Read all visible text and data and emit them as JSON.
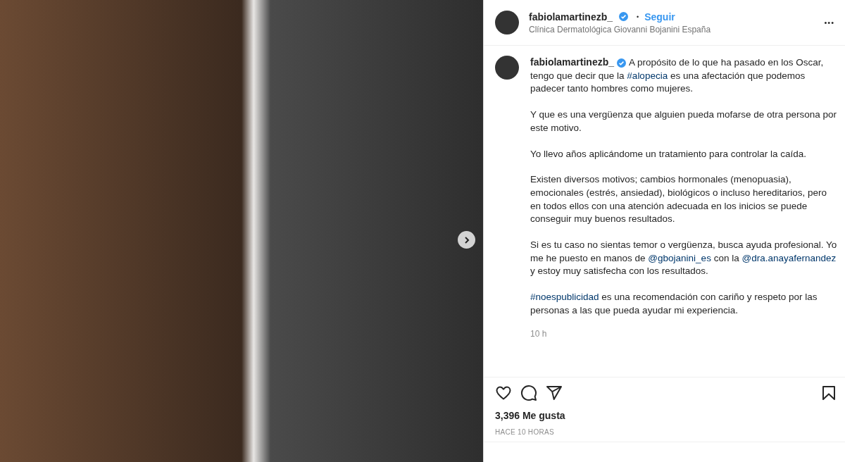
{
  "post": {
    "username": "fabiolamartinezb_",
    "verified": true,
    "separator": "•",
    "follow": "Seguir",
    "location": "Clínica Dermatológica Giovanni Bojanini España",
    "more": "•••"
  },
  "caption": {
    "username": "fabiolamartinezb_",
    "verified": true,
    "paragraphs": [
      [
        {
          "kind": "text",
          "text": "A propósito de lo que ha pasado en los Oscar, tengo que decir que la "
        },
        {
          "kind": "link",
          "text": "#alopecia"
        },
        {
          "kind": "text",
          "text": " es una afectación que podemos padecer tanto hombres como mujeres."
        }
      ],
      [
        {
          "kind": "text",
          "text": "Y que es una vergüenza que alguien pueda mofarse de otra persona por este motivo."
        }
      ],
      [
        {
          "kind": "text",
          "text": "Yo llevo años aplicándome un tratamiento para controlar la caída."
        }
      ],
      [
        {
          "kind": "text",
          "text": "Existen diversos motivos; cambios hormonales (menopuasia), emocionales (estrés, ansiedad), biológicos o incluso hereditarios, pero en todos ellos con una atención adecuada en los inicios se puede conseguir muy buenos resultados."
        }
      ],
      [
        {
          "kind": "text",
          "text": "Si es tu caso no sientas temor o vergüenza, busca ayuda profesional. Yo me he puesto en manos de "
        },
        {
          "kind": "link",
          "text": "@gbojanini_es"
        },
        {
          "kind": "text",
          "text": " con la "
        },
        {
          "kind": "link",
          "text": "@dra.anayafernandez"
        },
        {
          "kind": "text",
          "text": " y estoy muy satisfecha con los resultados."
        }
      ],
      [
        {
          "kind": "link",
          "text": "#noespublicidad"
        },
        {
          "kind": "text",
          "text": " es una recomendación con cariño y respeto por las personas a las que pueda ayudar mi experiencia."
        }
      ]
    ],
    "time": "10 h"
  },
  "actions": {
    "liked": false,
    "saved": false
  },
  "likes": "3,396 Me gusta",
  "timestamp": "HACE 10 HORAS"
}
